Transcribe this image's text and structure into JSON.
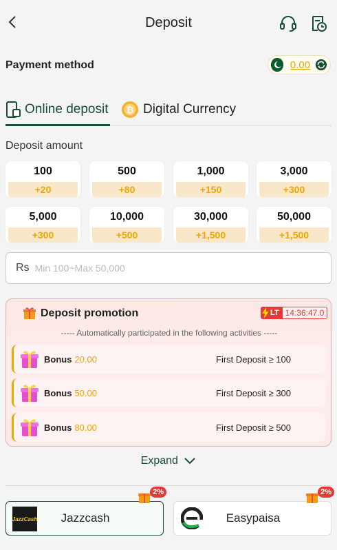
{
  "header": {
    "title": "Deposit"
  },
  "payment_method": {
    "label": "Payment method",
    "balance": "0.00"
  },
  "tabs": [
    {
      "label": "Online deposit",
      "active": true
    },
    {
      "label": "Digital Currency",
      "active": false
    }
  ],
  "deposit_amount": {
    "label": "Deposit amount",
    "options": [
      {
        "amount": "100",
        "bonus": "+20"
      },
      {
        "amount": "500",
        "bonus": "+80"
      },
      {
        "amount": "1,000",
        "bonus": "+150"
      },
      {
        "amount": "3,000",
        "bonus": "+300"
      },
      {
        "amount": "5,000",
        "bonus": "+300"
      },
      {
        "amount": "10,000",
        "bonus": "+500"
      },
      {
        "amount": "30,000",
        "bonus": "+1,500"
      },
      {
        "amount": "50,000",
        "bonus": "+1,500"
      }
    ],
    "currency": "Rs",
    "placeholder": "Min 100~Max 50,000"
  },
  "promotion": {
    "title": "Deposit promotion",
    "lt_label": "LT",
    "timer": "14:36:47.0",
    "subtitle": "----- Automatically participated in the following activities -----",
    "rows": [
      {
        "bonus_label": "Bonus",
        "bonus_value": "20.00",
        "condition": "First Deposit ≥ 100"
      },
      {
        "bonus_label": "Bonus",
        "bonus_value": "50.00",
        "condition": "First Deposit ≥ 300"
      },
      {
        "bonus_label": "Bonus",
        "bonus_value": "80.00",
        "condition": "First Deposit ≥ 500"
      }
    ],
    "expand_label": "Expand"
  },
  "methods": [
    {
      "name": "Jazzcash",
      "logo_text": "JazzCash",
      "badge": "2%",
      "selected": true
    },
    {
      "name": "Easypaisa",
      "badge": "2%",
      "selected": false
    }
  ],
  "colors": {
    "brand_green": "#174d33",
    "accent_gold": "#f3a400",
    "danger": "#e53935"
  }
}
